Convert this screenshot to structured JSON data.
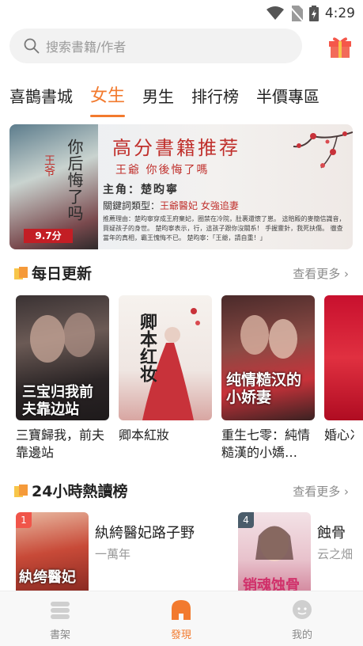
{
  "status_bar": {
    "time": "4:29",
    "icons": [
      "wifi-icon",
      "no-sim-icon",
      "battery-charging-icon"
    ]
  },
  "search": {
    "placeholder": "搜索書籍/作者",
    "icon": "search-icon"
  },
  "gift_icon": "gift-icon",
  "tabs": [
    {
      "label": "喜鵲書城",
      "active": false
    },
    {
      "label": "女生",
      "active": true
    },
    {
      "label": "男生",
      "active": false
    },
    {
      "label": "排行榜",
      "active": false
    },
    {
      "label": "半價專區",
      "active": false
    }
  ],
  "banner": {
    "cover_title": "你后悔了吗",
    "cover_subtitle": "王爷",
    "score": "9.7分",
    "title": "高分書籍推荐",
    "subtitle": "王爺 你後悔了嗎",
    "lead": "主角：楚昀寧",
    "keywords_label": "關鍵詞類型：",
    "keywords": "王爺醫妃 女強追妻",
    "description": "推薦理由：楚昀寧穿成王府棄妃，圈禁在冷院，肚裹還懷了崽。 這賠殿的麥簡信識音，買疑孩子的身世。 楚昀寧表示，行，這孩子跟你沒關系！ 手握靈針，我死扶傷。 徹查當年的真相，霸王愧悔不已。 楚昀寧：「王爺，請自重！」"
  },
  "daily_update": {
    "title": "每日更新",
    "more": "查看更多",
    "books": [
      {
        "title": "三寶歸我，前夫靠邊站",
        "cover_text": "三宝归我前夫靠边站"
      },
      {
        "title": "卿本紅妝",
        "cover_text": "卿本红妆"
      },
      {
        "title": "重生七零：純情糙漢的小嬌…",
        "cover_text": "纯情糙汉的小娇妻"
      },
      {
        "title": "婚心冫",
        "cover_text": ""
      }
    ]
  },
  "hot_24h": {
    "title": "24小時熱讀榜",
    "more": "查看更多",
    "items": [
      {
        "rank": "1",
        "title": "紈絝醫妃路子野",
        "author": "一萬年",
        "cover_text": "紈绔醫妃"
      },
      {
        "rank": "4",
        "title": "蝕骨",
        "author": "云之畑",
        "cover_text": "销魂蚀骨"
      }
    ]
  },
  "bottom_nav": [
    {
      "label": "書架",
      "icon": "bookshelf-icon",
      "active": false
    },
    {
      "label": "發現",
      "icon": "discover-icon",
      "active": true
    },
    {
      "label": "我的",
      "icon": "profile-icon",
      "active": false
    }
  ],
  "colors": {
    "accent": "#f27a2e",
    "banner_red": "#c0302c",
    "rank1": "#f0554a",
    "rank4": "#4a5c6a"
  }
}
